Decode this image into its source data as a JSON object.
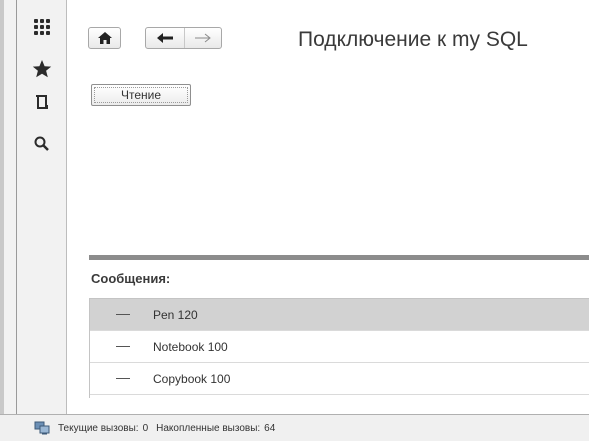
{
  "sidebar": {
    "items": [
      {
        "icon": "grid-icon"
      },
      {
        "icon": "star-icon"
      },
      {
        "icon": "history-icon"
      },
      {
        "icon": "search-icon"
      }
    ]
  },
  "toolbar": {
    "home_icon": "home-icon",
    "back_icon": "arrow-left-icon",
    "forward_icon": "arrow-right-icon"
  },
  "page": {
    "title": "Подключение к my SQL",
    "read_button_label": "Чтение"
  },
  "messages": {
    "label": "Сообщения:",
    "items": [
      "Pen 120",
      "Notebook 100",
      "Copybook 100"
    ],
    "selected_index": 0
  },
  "status": {
    "current_calls_label": "Текущие вызовы:",
    "current_calls_value": "0",
    "accumulated_calls_label": "Накопленные вызовы:",
    "accumulated_calls_value": "64"
  },
  "colors": {
    "sidebar_bg": "#f2f2f2",
    "selected_row": "#d2d2d2",
    "splitter": "#8c8c8c"
  }
}
